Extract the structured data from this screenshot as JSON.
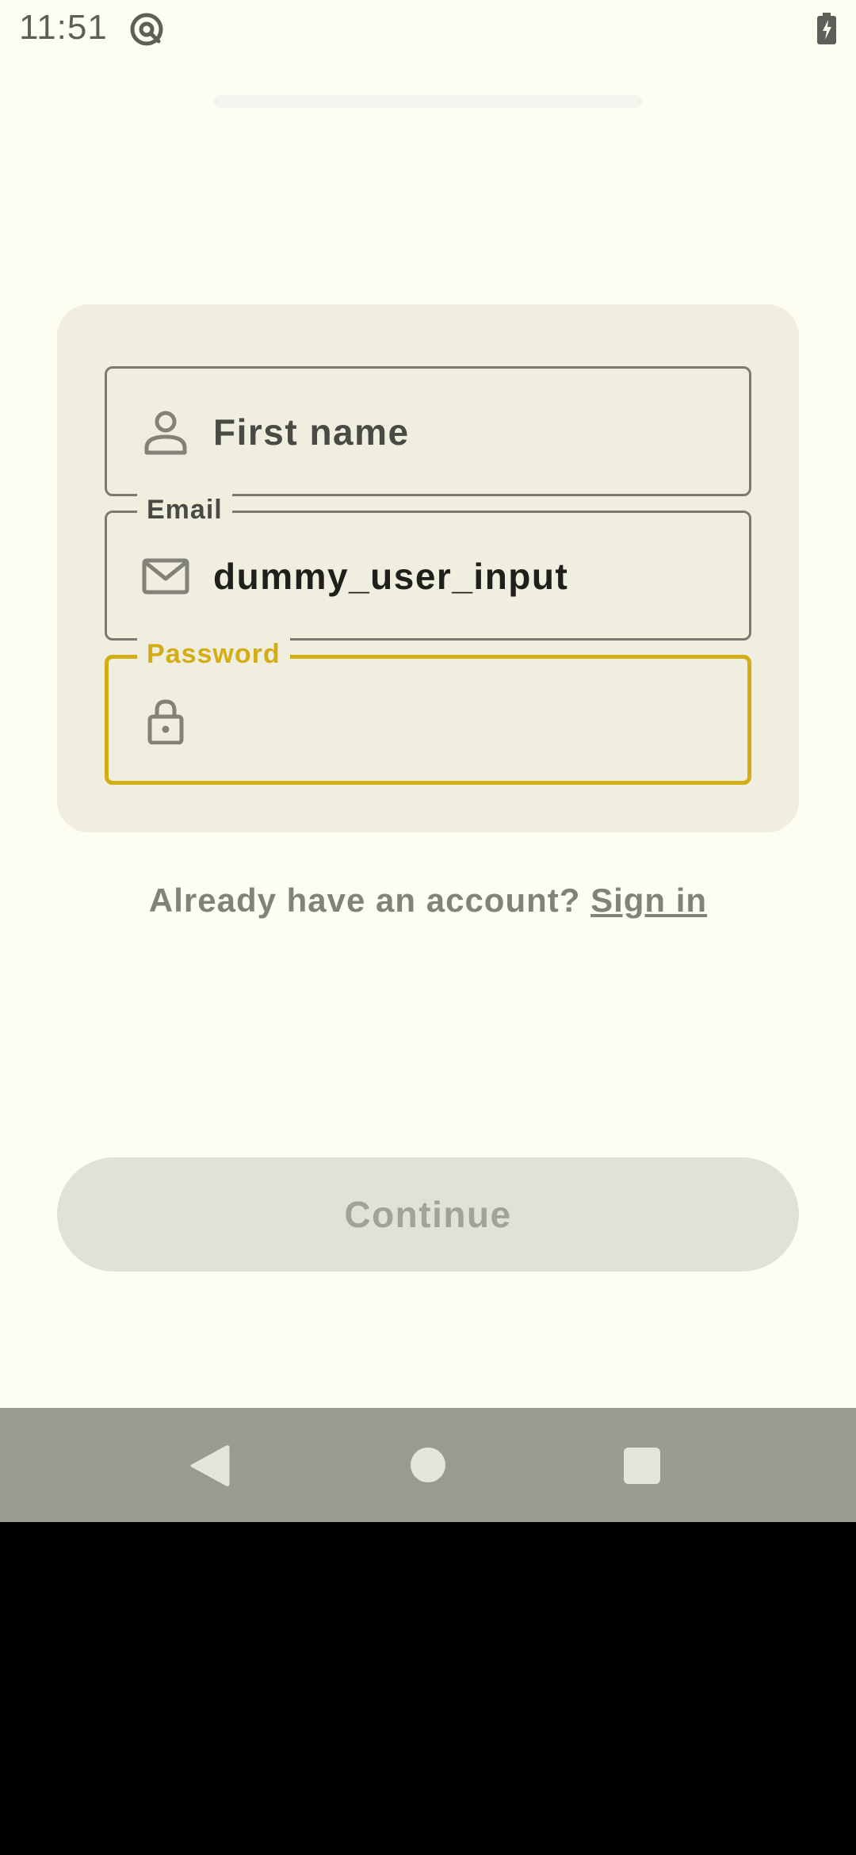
{
  "status_bar": {
    "time": "11:51",
    "app_icon": "at-sign-icon",
    "battery_icon": "battery-charging-icon"
  },
  "form": {
    "first_name": {
      "placeholder": "First name",
      "icon": "person-icon"
    },
    "email": {
      "label": "Email",
      "value": "dummy_user_input",
      "icon": "mail-icon"
    },
    "password": {
      "label": "Password",
      "value": "",
      "icon": "lock-icon"
    }
  },
  "signin": {
    "prompt": "Already have an account?",
    "link": "Sign in"
  },
  "continue_button": {
    "label": "Continue"
  },
  "nav": {
    "back_icon": "back-triangle-icon",
    "home_icon": "home-circle-icon",
    "recents_icon": "recents-square-icon"
  },
  "colors": {
    "background": "#fdfdf1",
    "card": "#efeedf",
    "focus_accent": "#d4ad16",
    "button_disabled": "#e2e1d6",
    "nav_bar": "#9b9a92"
  }
}
